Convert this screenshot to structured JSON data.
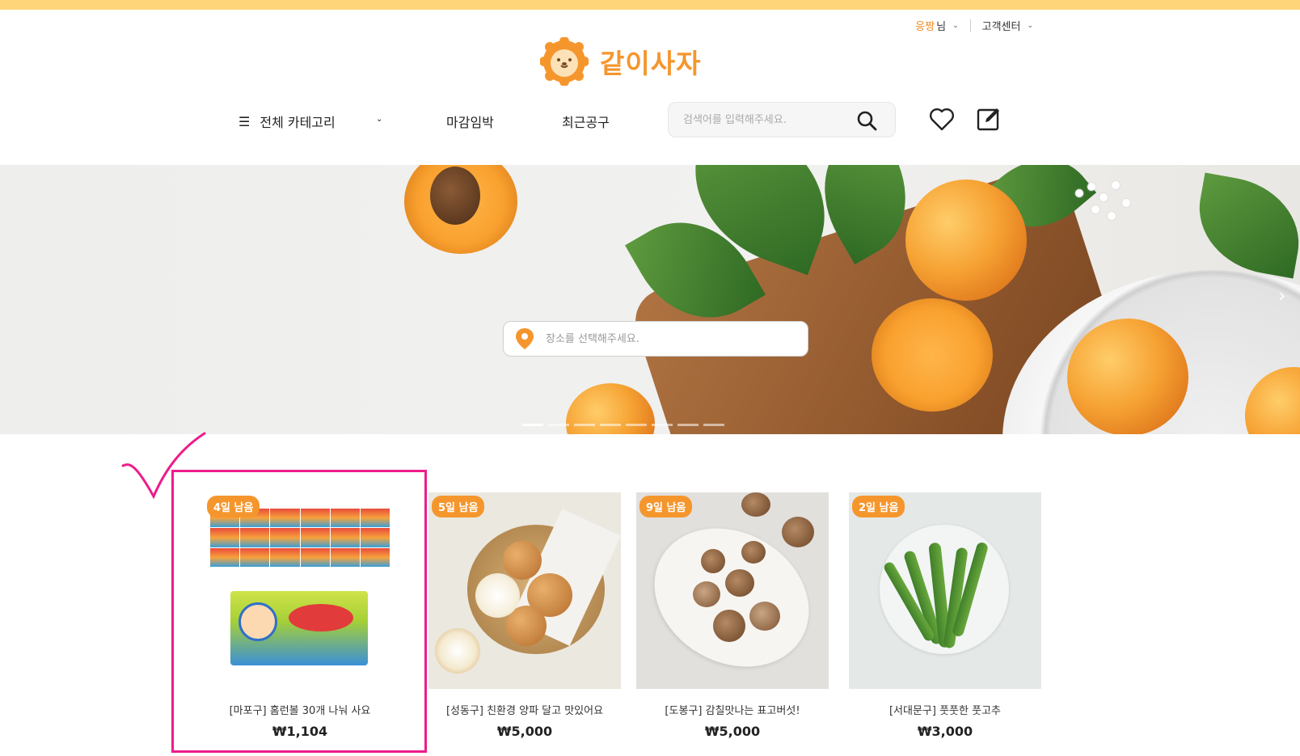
{
  "header": {
    "user_name": "응짱",
    "user_suffix": "님",
    "support_label": "고객센터",
    "logo_text": "같이사자"
  },
  "nav": {
    "category_label": "전체 카테고리",
    "deadline_label": "마감임박",
    "recent_label": "최근공구",
    "search_placeholder": "검색어를 입력해주세요."
  },
  "banner": {
    "location_placeholder": "장소를 선택해주세요.",
    "slide_count": 8,
    "active_slide": 1
  },
  "products": [
    {
      "badge": "4일 남음",
      "title": "[마포구] 홈런볼 30개 나눠 사요",
      "price": "₩1,104"
    },
    {
      "badge": "5일 남음",
      "title": "[성동구] 친환경 양파 달고 맛있어요",
      "price": "₩5,000"
    },
    {
      "badge": "9일 남음",
      "title": "[도봉구] 감칠맛나는 표고버섯!",
      "price": "₩5,000"
    },
    {
      "badge": "2일 남음",
      "title": "[서대문구] 풋풋한 풋고추",
      "price": "₩3,000"
    }
  ],
  "colors": {
    "accent": "#f5962d",
    "topbar": "#ffd57a",
    "highlight": "#ee1c8c"
  }
}
